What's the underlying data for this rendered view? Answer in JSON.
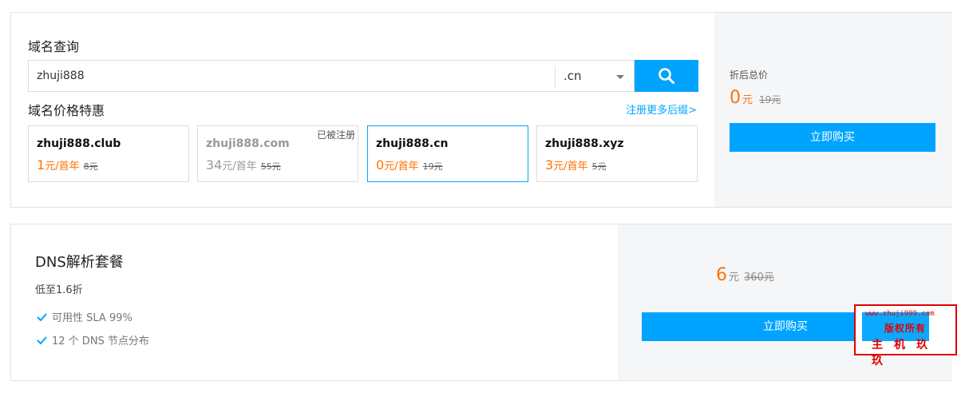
{
  "domain_query": {
    "title": "域名查询",
    "search_value": "zhuji888",
    "suffix_selected": ".cn",
    "search_icon": "search-icon"
  },
  "domain_price": {
    "title": "域名价格特惠",
    "more_link": "注册更多后缀>",
    "items": [
      {
        "name": "zhuji888.club",
        "price": "1",
        "unit": "元/首年",
        "old": "8元",
        "badge": ""
      },
      {
        "name": "zhuji888.com",
        "price": "34",
        "unit": "元/首年",
        "old": "55元",
        "badge": "已被注册"
      },
      {
        "name": "zhuji888.cn",
        "price": "0",
        "unit": "元/首年",
        "old": "19元",
        "badge": ""
      },
      {
        "name": "zhuji888.xyz",
        "price": "3",
        "unit": "元/首年",
        "old": "5元",
        "badge": ""
      }
    ]
  },
  "summary": {
    "label": "折后总价",
    "price": "0",
    "unit": "元",
    "old": "19元",
    "buy_label": "立即购买"
  },
  "dns": {
    "title": "DNS解析套餐",
    "subtitle": "低至1.6折",
    "features": [
      "可用性 SLA 99%",
      "12 个 DNS 节点分布"
    ],
    "price": "6",
    "unit": "元",
    "old": "360元",
    "buy_label": "立即购买"
  },
  "watermark": {
    "line1": "www.zhuji999.com",
    "line2": "版权所有",
    "line3": "主机玖玖"
  },
  "colors": {
    "accent": "#00a4ff",
    "price": "#ff7200",
    "watermark": "#e00000"
  }
}
